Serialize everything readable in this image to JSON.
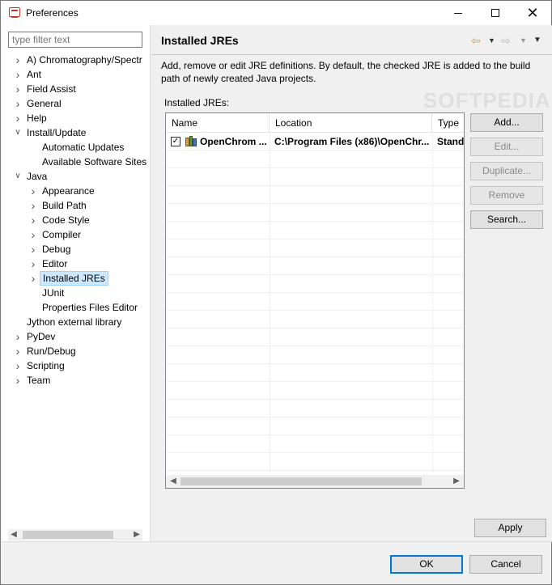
{
  "window": {
    "title": "Preferences"
  },
  "filter": {
    "placeholder": "type filter text"
  },
  "tree": [
    {
      "label": "A) Chromatography/Spectr",
      "level": 0,
      "twisty": "collapsed"
    },
    {
      "label": "Ant",
      "level": 0,
      "twisty": "collapsed"
    },
    {
      "label": "Field Assist",
      "level": 0,
      "twisty": "collapsed"
    },
    {
      "label": "General",
      "level": 0,
      "twisty": "collapsed"
    },
    {
      "label": "Help",
      "level": 0,
      "twisty": "collapsed"
    },
    {
      "label": "Install/Update",
      "level": 0,
      "twisty": "expanded"
    },
    {
      "label": "Automatic Updates",
      "level": 1,
      "twisty": "none"
    },
    {
      "label": "Available Software Sites",
      "level": 1,
      "twisty": "none"
    },
    {
      "label": "Java",
      "level": 0,
      "twisty": "expanded"
    },
    {
      "label": "Appearance",
      "level": 1,
      "twisty": "collapsed"
    },
    {
      "label": "Build Path",
      "level": 1,
      "twisty": "collapsed"
    },
    {
      "label": "Code Style",
      "level": 1,
      "twisty": "collapsed"
    },
    {
      "label": "Compiler",
      "level": 1,
      "twisty": "collapsed"
    },
    {
      "label": "Debug",
      "level": 1,
      "twisty": "collapsed"
    },
    {
      "label": "Editor",
      "level": 1,
      "twisty": "collapsed"
    },
    {
      "label": "Installed JREs",
      "level": 1,
      "twisty": "collapsed",
      "selected": true
    },
    {
      "label": "JUnit",
      "level": 1,
      "twisty": "none"
    },
    {
      "label": "Properties Files Editor",
      "level": 1,
      "twisty": "none"
    },
    {
      "label": "Jython external library",
      "level": 0,
      "twisty": "none"
    },
    {
      "label": "PyDev",
      "level": 0,
      "twisty": "collapsed"
    },
    {
      "label": "Run/Debug",
      "level": 0,
      "twisty": "collapsed"
    },
    {
      "label": "Scripting",
      "level": 0,
      "twisty": "collapsed"
    },
    {
      "label": "Team",
      "level": 0,
      "twisty": "collapsed"
    }
  ],
  "page": {
    "title": "Installed JREs",
    "description": "Add, remove or edit JRE definitions. By default, the checked JRE is added to the build path of newly created Java projects.",
    "table_label": "Installed JREs:",
    "columns": [
      "Name",
      "Location",
      "Type"
    ],
    "rows": [
      {
        "checked": true,
        "name": "OpenChrom ...",
        "location": "C:\\Program Files (x86)\\OpenChr...",
        "type": "Standa"
      }
    ],
    "buttons": {
      "add": "Add...",
      "edit": "Edit...",
      "duplicate": "Duplicate...",
      "remove": "Remove",
      "search": "Search..."
    },
    "apply": "Apply"
  },
  "dialog": {
    "ok": "OK",
    "cancel": "Cancel"
  },
  "watermark": "SOFTPEDIA",
  "colors": {
    "selection": "#cce8ff",
    "default_button_border": "#0078d7"
  }
}
